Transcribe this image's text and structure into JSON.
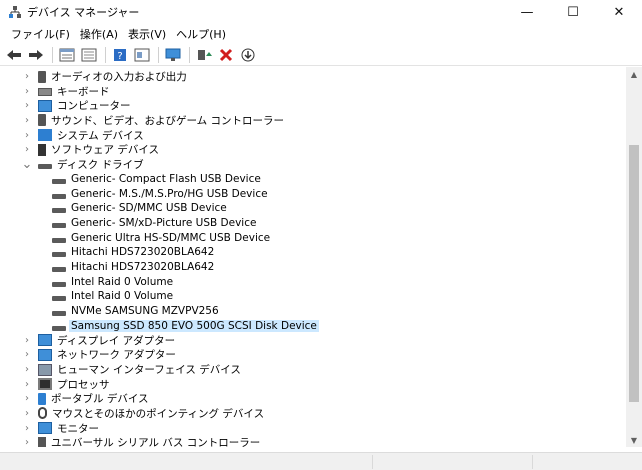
{
  "window": {
    "title": "デバイス マネージャー",
    "controls": {
      "minimize": "—",
      "maximize": "☐",
      "close": "✕"
    }
  },
  "menu": [
    "ファイル(F)",
    "操作(A)",
    "表示(V)",
    "ヘルプ(H)"
  ],
  "toolbar": {
    "buttons": [
      {
        "name": "back-icon",
        "glyph": "🡄"
      },
      {
        "name": "forward-icon",
        "glyph": "🡆"
      },
      {
        "name": "properties-icon",
        "glyph": "▤"
      },
      {
        "name": "refresh-icon",
        "glyph": "▦"
      },
      {
        "name": "help-icon",
        "glyph": "?"
      },
      {
        "name": "view-icon",
        "glyph": "▣"
      },
      {
        "name": "scan-hardware-icon",
        "glyph": "▭"
      },
      {
        "name": "update-driver-icon",
        "glyph": "▲"
      },
      {
        "name": "uninstall-icon",
        "glyph": "✖"
      },
      {
        "name": "download-icon",
        "glyph": "⊕"
      }
    ],
    "colors": {
      "uninstall": "#d11e1e",
      "update": "#2e8b57",
      "help": "#2b6cc4"
    }
  },
  "tree": [
    {
      "label": "オーディオの入力および出力",
      "level": 0,
      "state": "collapsed",
      "icon": "speaker-icon"
    },
    {
      "label": "キーボード",
      "level": 0,
      "state": "collapsed",
      "icon": "keyboard-icon"
    },
    {
      "label": "コンピューター",
      "level": 0,
      "state": "collapsed",
      "icon": "computer-icon"
    },
    {
      "label": "サウンド、ビデオ、およびゲーム コントローラー",
      "level": 0,
      "state": "collapsed",
      "icon": "speaker-icon"
    },
    {
      "label": "システム デバイス",
      "level": 0,
      "state": "collapsed",
      "icon": "folder-icon"
    },
    {
      "label": "ソフトウェア デバイス",
      "level": 0,
      "state": "collapsed",
      "icon": "software-device-icon"
    },
    {
      "label": "ディスク ドライブ",
      "level": 0,
      "state": "expanded",
      "icon": "disk-drive-icon"
    },
    {
      "label": "Generic- Compact Flash USB Device",
      "level": 1,
      "state": "leaf",
      "icon": "disk-drive-icon"
    },
    {
      "label": "Generic- M.S./M.S.Pro/HG USB Device",
      "level": 1,
      "state": "leaf",
      "icon": "disk-drive-icon"
    },
    {
      "label": "Generic- SD/MMC USB Device",
      "level": 1,
      "state": "leaf",
      "icon": "disk-drive-icon"
    },
    {
      "label": "Generic- SM/xD-Picture USB Device",
      "level": 1,
      "state": "leaf",
      "icon": "disk-drive-icon"
    },
    {
      "label": "Generic Ultra HS-SD/MMC USB Device",
      "level": 1,
      "state": "leaf",
      "icon": "disk-drive-icon"
    },
    {
      "label": "Hitachi HDS723020BLA642",
      "level": 1,
      "state": "leaf",
      "icon": "disk-drive-icon"
    },
    {
      "label": "Hitachi HDS723020BLA642",
      "level": 1,
      "state": "leaf",
      "icon": "disk-drive-icon"
    },
    {
      "label": "Intel Raid 0 Volume",
      "level": 1,
      "state": "leaf",
      "icon": "disk-drive-icon"
    },
    {
      "label": "Intel Raid 0 Volume",
      "level": 1,
      "state": "leaf",
      "icon": "disk-drive-icon"
    },
    {
      "label": "NVMe SAMSUNG MZVPV256",
      "level": 1,
      "state": "leaf",
      "icon": "disk-drive-icon"
    },
    {
      "label": "Samsung SSD 850 EVO 500G SCSI Disk Device",
      "level": 1,
      "state": "leaf",
      "icon": "disk-drive-icon",
      "selected": true
    },
    {
      "label": "ディスプレイ アダプター",
      "level": 0,
      "state": "collapsed",
      "icon": "display-adapter-icon"
    },
    {
      "label": "ネットワーク アダプター",
      "level": 0,
      "state": "collapsed",
      "icon": "network-adapter-icon"
    },
    {
      "label": "ヒューマン インターフェイス デバイス",
      "level": 0,
      "state": "collapsed",
      "icon": "hid-icon"
    },
    {
      "label": "プロセッサ",
      "level": 0,
      "state": "collapsed",
      "icon": "processor-icon"
    },
    {
      "label": "ポータブル デバイス",
      "level": 0,
      "state": "collapsed",
      "icon": "portable-device-icon"
    },
    {
      "label": "マウスとそのほかのポインティング デバイス",
      "level": 0,
      "state": "collapsed",
      "icon": "mouse-icon"
    },
    {
      "label": "モニター",
      "level": 0,
      "state": "collapsed",
      "icon": "monitor-icon"
    },
    {
      "label": "ユニバーサル シリアル バス コントローラー",
      "level": 0,
      "state": "collapsed",
      "icon": "usb-icon"
    }
  ],
  "colors": {
    "selection": "#cce8ff",
    "accent": "#3f8fd8"
  }
}
